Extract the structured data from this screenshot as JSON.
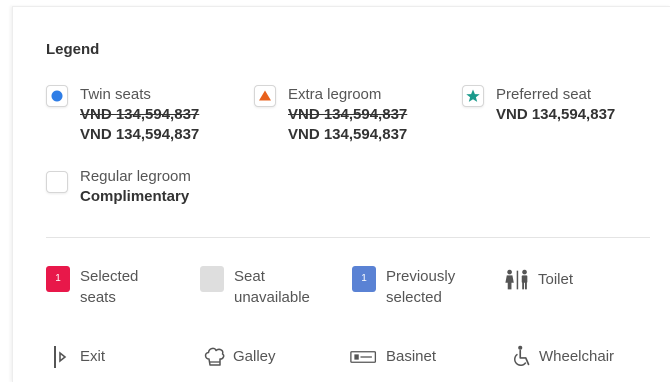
{
  "legend": {
    "title": "Legend",
    "twin": {
      "label": "Twin seats",
      "price_old": "VND 134,594,837",
      "price_new": "VND 134,594,837",
      "color": "#2e7de6"
    },
    "extra": {
      "label": "Extra legroom",
      "price_old": "VND 134,594,837",
      "price_new": "VND 134,594,837",
      "color": "#e8611c"
    },
    "preferred": {
      "label": "Preferred seat",
      "price": "VND 134,594,837",
      "color": "#1a9a8c"
    },
    "regular": {
      "label": "Regular legroom",
      "price": "Complimentary"
    }
  },
  "status": {
    "selected": {
      "label_1": "Selected",
      "label_2": "seats",
      "badge": "1",
      "color": "#e8184a"
    },
    "unavailable": {
      "label_1": "Seat",
      "label_2": "unavailable",
      "color": "#dedede"
    },
    "previous": {
      "label_1": "Previously",
      "label_2": "selected",
      "badge": "1",
      "color": "#5a82d4"
    },
    "toilet": {
      "label": "Toilet"
    }
  },
  "facilities": {
    "exit": {
      "label": "Exit"
    },
    "galley": {
      "label": "Galley"
    },
    "basinet": {
      "label": "Basinet"
    },
    "wheelchair": {
      "label": "Wheelchair"
    }
  }
}
